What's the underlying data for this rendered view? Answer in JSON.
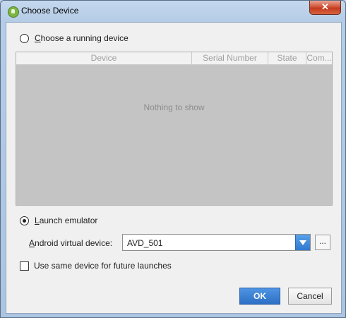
{
  "window": {
    "title": "Choose Device",
    "close_label": "✕"
  },
  "running": {
    "label_mnemonic": "C",
    "label_rest": "hoose a running device",
    "selected": false,
    "columns": [
      "Device",
      "Serial Number",
      "State",
      "Com..."
    ],
    "empty_text": "Nothing to show"
  },
  "emulator": {
    "label_mnemonic": "L",
    "label_rest": "aunch emulator",
    "selected": true,
    "avd_label_mnemonic": "A",
    "avd_label_rest": "ndroid virtual device:",
    "avd_value": "AVD_501",
    "browse_label": "..."
  },
  "same_device": {
    "label": "Use same device for future launches",
    "checked": false
  },
  "buttons": {
    "ok": "OK",
    "cancel": "Cancel"
  },
  "colors": {
    "accent": "#2d6fc5",
    "table_empty_bg": "#c4c4c4"
  }
}
